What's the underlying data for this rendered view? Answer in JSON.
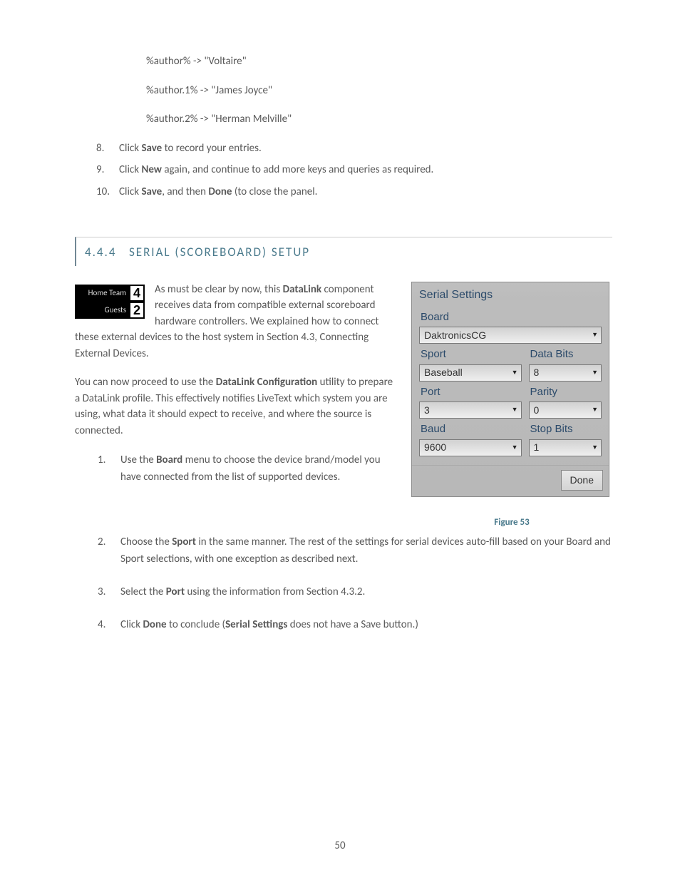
{
  "examples": {
    "line1": "%author% -> \"Voltaire\"",
    "line2": "%author.1% -> \"James Joyce\"",
    "line3": "%author.2% -> \"Herman Melville\""
  },
  "list_a": {
    "n8": "8.",
    "t8_a": "Click ",
    "t8_b": "Save",
    "t8_c": " to record your entries.",
    "n9": "9.",
    "t9_a": "Click ",
    "t9_b": "New",
    "t9_c": " again, and continue to add more keys and queries as required.",
    "n10": "10.",
    "t10_a": "Click ",
    "t10_b": "Save",
    "t10_c": ", and then ",
    "t10_d": "Done",
    "t10_e": " (to close the panel."
  },
  "section": {
    "num": "4.4.4",
    "title": "SERIAL (SCOREBOARD) SETUP"
  },
  "scoreboard": {
    "home_label": "Home Team",
    "home_score": "4",
    "guests_label": "Guests",
    "guests_score": "2"
  },
  "body": {
    "p1_a": "As must be clear by now, this ",
    "p1_b": "DataLink",
    "p1_c": " component receives data from compatible external scoreboard hardware controllers. We explained how to connect these external devices to the host system in Section 4.3, Connecting External Devices.",
    "p2_a": "You can now proceed to use the ",
    "p2_b": "DataLink Configuration",
    "p2_c": " utility to prepare a DataLink profile. This effectively notifies LiveText which system you are using, what data it should expect to receive, and where the source is connected."
  },
  "serial": {
    "title": "Serial Settings",
    "board": "Board",
    "board_val": "DaktronicsCG",
    "sport": "Sport",
    "databits": "Data Bits",
    "sport_val": "Baseball",
    "databits_val": "8",
    "port": "Port",
    "parity": "Parity",
    "port_val": "3",
    "parity_val": "0",
    "baud": "Baud",
    "stopbits": "Stop Bits",
    "baud_val": "9600",
    "stopbits_val": "1",
    "done": "Done"
  },
  "figcap": "Figure 53",
  "list_b": {
    "n1": "1.",
    "t1_a": "Use the ",
    "t1_b": "Board",
    "t1_c": " menu to choose the device brand/model you have connected from the list of supported devices.",
    "n2": "2.",
    "t2_a": "Choose the ",
    "t2_b": "Sport",
    "t2_c": " in the same manner.  The rest of the settings for serial devices auto-fill based on your Board and Sport selections, with one exception as described next.",
    "n3": "3.",
    "t3_a": "Select the ",
    "t3_b": "Port",
    "t3_c": " using the information from Section 4.3.2.",
    "n4": "4.",
    "t4_a": "Click ",
    "t4_b": "Done",
    "t4_c": " to conclude (",
    "t4_d": "Serial Settings",
    "t4_e": " does not have a Save button.)"
  },
  "page": "50"
}
